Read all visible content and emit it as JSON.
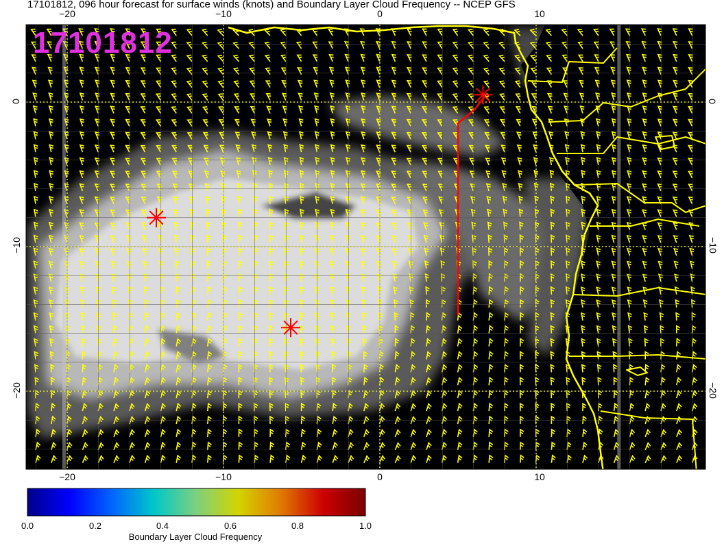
{
  "title": "17101812, 096 hour forecast for surface winds (knots) and Boundary Layer Cloud Frequency -- NCEP GFS",
  "stamp": "17101812",
  "axes": {
    "lon_ticks": [
      "−20",
      "−10",
      "0",
      "10"
    ],
    "lat_ticks": [
      "0",
      "−10",
      "−20"
    ]
  },
  "colorbar": {
    "label": "Boundary Layer Cloud Frequency",
    "ticks": [
      "0.0",
      "0.2",
      "0.4",
      "0.6",
      "0.8",
      "1.0"
    ],
    "stops": [
      "#00008b",
      "#0000ff",
      "#0066ff",
      "#00c8c8",
      "#7ed07e",
      "#d4d400",
      "#e07a00",
      "#cc0000",
      "#7a0000"
    ]
  },
  "colors": {
    "background": "#000000",
    "wind_barb": "#ffff00",
    "coastline": "#ffff00",
    "marker": "#ff0000",
    "track": "#ff0000"
  },
  "markers": [
    {
      "name": "asterisk",
      "lon": -14.3,
      "lat": -8.0
    },
    {
      "name": "asterisk",
      "lon": -5.7,
      "lat": -15.6
    },
    {
      "name": "asterisk",
      "lon": 6.6,
      "lat": 0.5
    }
  ]
}
